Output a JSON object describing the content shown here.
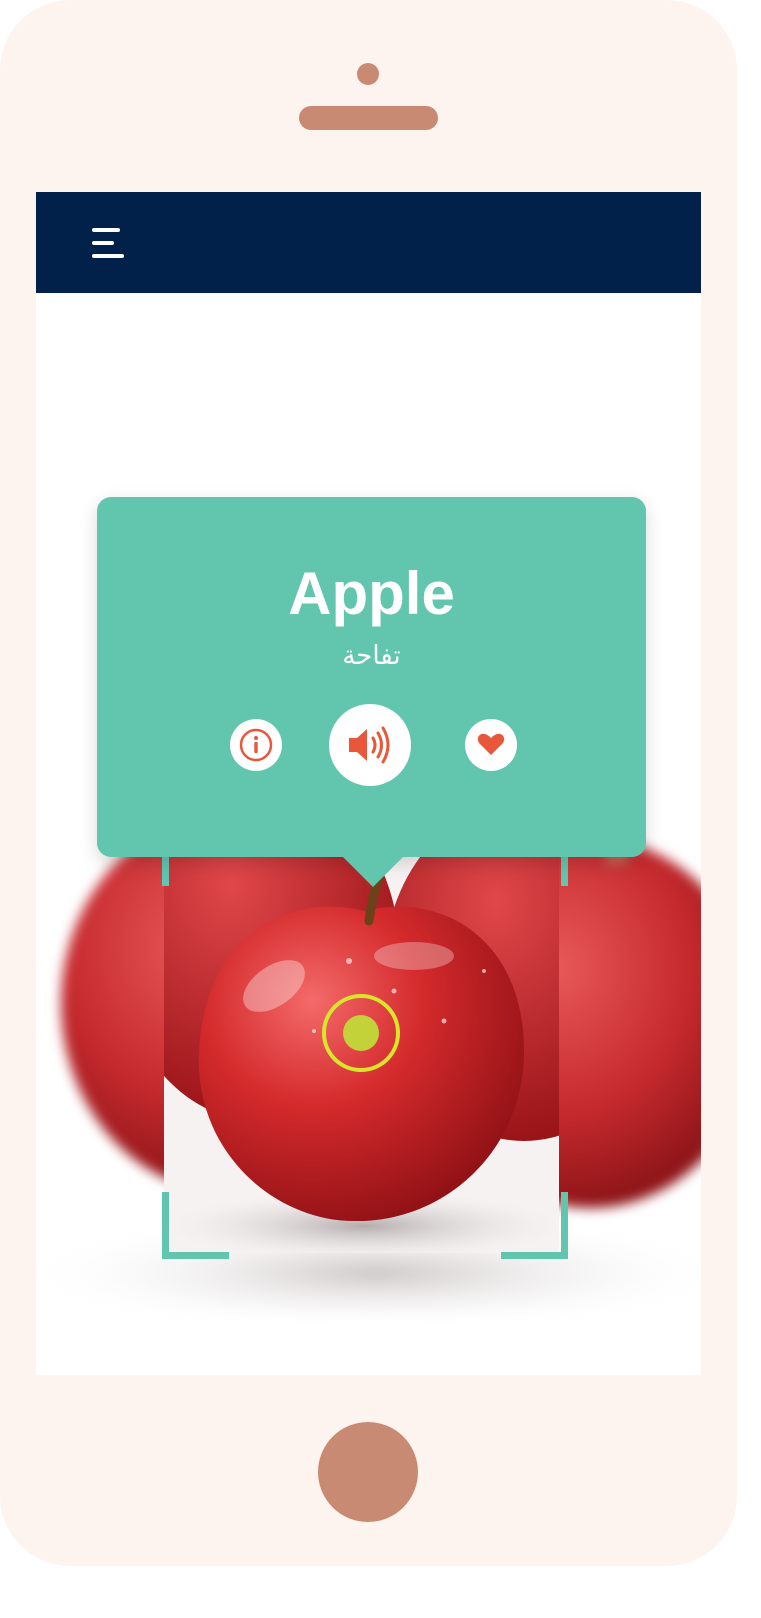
{
  "navbar": {
    "menu_icon": "hamburger-menu-icon",
    "background_color": "#01214a"
  },
  "result": {
    "word": "Apple",
    "translation": "تفاحة",
    "card_color": "#62c6ae",
    "actions": [
      {
        "name": "info",
        "icon": "info-icon"
      },
      {
        "name": "sound",
        "icon": "speaker-icon"
      },
      {
        "name": "favorite",
        "icon": "heart-icon"
      }
    ],
    "icon_color": "#e8573a"
  },
  "camera": {
    "frame_color": "#62c6ae",
    "target_color": "#d8e52a"
  },
  "device": {
    "body_color": "#fdf4ef",
    "accent_color": "#c98a74"
  }
}
